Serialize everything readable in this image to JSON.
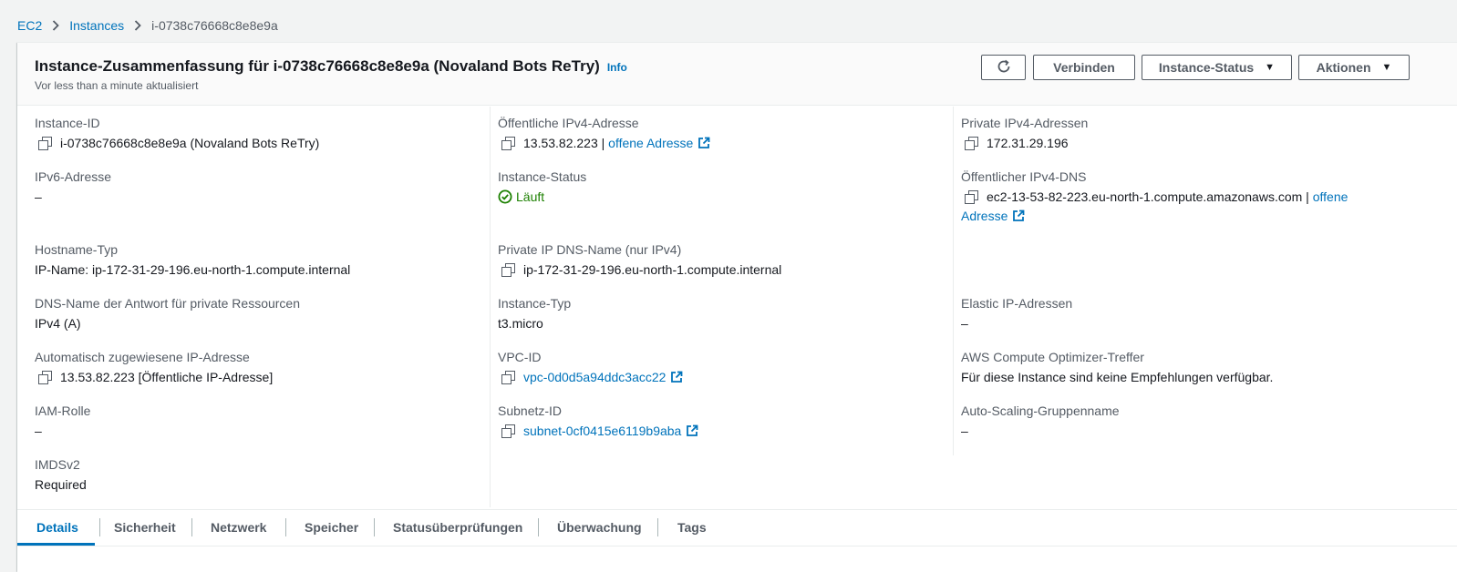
{
  "breadcrumb": {
    "items": [
      "EC2",
      "Instances",
      "i-0738c76668c8e8e9a"
    ]
  },
  "header": {
    "title": "Instance-Zusammenfassung für i-0738c76668c8e8e9a (Novaland Bots ReTry)",
    "info_label": "Info",
    "subtitle": "Vor less than a minute aktualisiert",
    "buttons": {
      "refresh_icon": "refresh-icon",
      "connect": "Verbinden",
      "instance_status": "Instance-Status",
      "actions": "Aktionen"
    }
  },
  "fields": {
    "instance_id": {
      "label": "Instance-ID",
      "value": "i-0738c76668c8e8e9a (Novaland Bots ReTry)"
    },
    "ipv6": {
      "label": "IPv6-Adresse",
      "value": "–"
    },
    "hostname_type": {
      "label": "Hostname-Typ",
      "value": "IP-Name: ip-172-31-29-196.eu-north-1.compute.internal"
    },
    "dns_answer": {
      "label": "DNS-Name der Antwort für private Ressourcen",
      "value": "IPv4 (A)"
    },
    "auto_ip": {
      "label": "Automatisch zugewiesene IP-Adresse",
      "value": "13.53.82.223 [Öffentliche IP-Adresse]"
    },
    "iam_role": {
      "label": "IAM-Rolle",
      "value": "–"
    },
    "imdsv2": {
      "label": "IMDSv2",
      "value": "Required"
    },
    "public_ipv4": {
      "label": "Öffentliche IPv4-Adresse",
      "value": "13.53.82.223",
      "sep": " | ",
      "link": "offene Adresse"
    },
    "instance_state": {
      "label": "Instance-Status",
      "value": "Läuft",
      "color": "#1d8102"
    },
    "private_ip_dns": {
      "label": "Private IP DNS-Name (nur IPv4)",
      "value": "ip-172-31-29-196.eu-north-1.compute.internal"
    },
    "instance_type": {
      "label": "Instance-Typ",
      "value": "t3.micro"
    },
    "vpc_id": {
      "label": "VPC-ID",
      "link": "vpc-0d0d5a94ddc3acc22"
    },
    "subnet_id": {
      "label": "Subnetz-ID",
      "link": "subnet-0cf0415e6119b9aba"
    },
    "private_ipv4": {
      "label": "Private IPv4-Adressen",
      "value": "172.31.29.196"
    },
    "public_dns": {
      "label": "Öffentlicher IPv4-DNS",
      "value": "ec2-13-53-82-223.eu-north-1.compute.amazonaws.com",
      "sep": " | ",
      "link_part1": "offene",
      "link_part2": "Adresse"
    },
    "elastic_ip": {
      "label": "Elastic IP-Adressen",
      "value": "–"
    },
    "optimizer": {
      "label": "AWS Compute Optimizer-Treffer",
      "value": "Für diese Instance sind keine Empfehlungen verfügbar."
    },
    "asg_name": {
      "label": "Auto-Scaling-Gruppenname",
      "value": "–"
    }
  },
  "tabs": [
    {
      "label": "Details",
      "active": true
    },
    {
      "label": "Sicherheit"
    },
    {
      "label": "Netzwerk"
    },
    {
      "label": "Speicher"
    },
    {
      "label": "Statusüberprüfungen"
    },
    {
      "label": "Überwachung"
    },
    {
      "label": "Tags"
    }
  ],
  "colors": {
    "link": "#0073bb",
    "running": "#1d8102",
    "text": "#16191f",
    "muted": "#545b64"
  }
}
